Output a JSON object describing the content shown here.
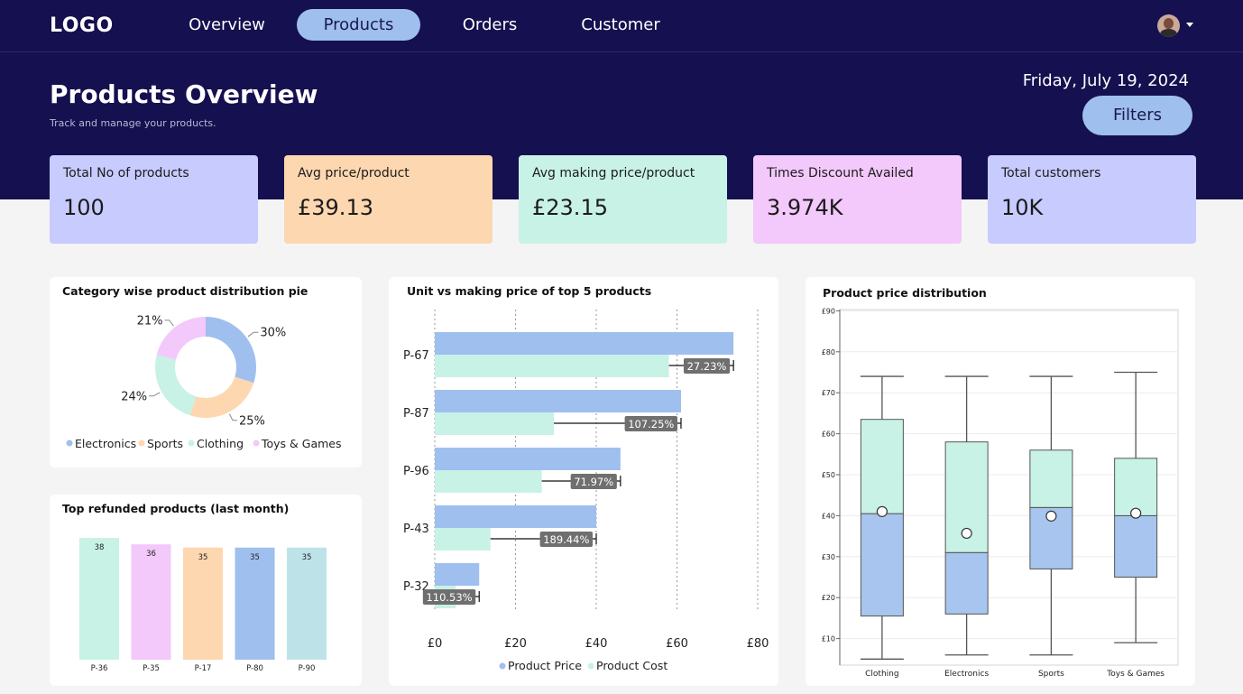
{
  "nav": {
    "logo": "LOGO",
    "items": [
      {
        "label": "Overview",
        "active": false
      },
      {
        "label": "Products",
        "active": true
      },
      {
        "label": "Orders",
        "active": false
      },
      {
        "label": "Customer",
        "active": false
      }
    ],
    "avatar_icon": "user-avatar",
    "menu_icon": "caret-down-icon"
  },
  "header": {
    "title": "Products Overview",
    "subtitle": "Track and manage your products.",
    "date": "Friday, July 19, 2024",
    "filters_label": "Filters"
  },
  "kpis": [
    {
      "label": "Total No of products",
      "value": "100",
      "color": "#c7cbfd"
    },
    {
      "label": "Avg price/product",
      "value": "£39.13",
      "color": "#fdd7b0"
    },
    {
      "label": "Avg making price/product",
      "value": "£23.15",
      "color": "#c8f2e6"
    },
    {
      "label": "Times Discount Availed",
      "value": "3.974K",
      "color": "#f3c8fb"
    },
    {
      "label": "Total customers",
      "value": "10K",
      "color": "#c7cbfd"
    }
  ],
  "cards": {
    "pie_title": "Category wise product distribution pie",
    "refund_title": "Top refunded products (last month)",
    "hbar_title": "Unit vs making price of top 5  products",
    "box_title": "Product price distribution"
  },
  "chart_data": [
    {
      "type": "pie",
      "title": "Category wise product distribution pie",
      "donut": true,
      "slices": [
        {
          "label": "Electronics",
          "value": 30,
          "text": "30%",
          "color": "#9fbfef"
        },
        {
          "label": "Sports",
          "value": 25,
          "text": "25%",
          "color": "#fdd7b0"
        },
        {
          "label": "Clothing",
          "value": 24,
          "text": "24%",
          "color": "#c8f2e6"
        },
        {
          "label": "Toys & Games",
          "value": 21,
          "text": "21%",
          "color": "#f3c8fb"
        }
      ],
      "legend_position": "bottom"
    },
    {
      "type": "bar",
      "title": "Top refunded products (last month)",
      "categories": [
        "P-36",
        "P-35",
        "P-17",
        "P-80",
        "P-90"
      ],
      "values": [
        38,
        36,
        35,
        35,
        35
      ],
      "colors": [
        "#c8f2e6",
        "#f3c8fb",
        "#fdd7b0",
        "#9fbfef",
        "#bde3e8"
      ],
      "ylim": [
        0,
        40
      ],
      "grid": false
    },
    {
      "type": "bar",
      "orientation": "horizontal",
      "title": "Unit vs making price of top 5  products",
      "categories": [
        "P-67",
        "P-87",
        "P-96",
        "P-43",
        "P-32"
      ],
      "series": [
        {
          "name": "Product Price",
          "values": [
            74,
            61,
            46,
            40,
            11
          ],
          "color": "#9fbfef"
        },
        {
          "name": "Product Cost",
          "values": [
            58,
            29.5,
            26.5,
            13.8,
            5.2
          ],
          "color": "#c8f2e6"
        }
      ],
      "annotations": [
        "27.23%",
        "107.25%",
        "71.97%",
        "189.44%",
        "110.53%"
      ],
      "xticks": [
        "£0",
        "£20",
        "£40",
        "£60",
        "£80"
      ],
      "xlim": [
        0,
        80
      ],
      "grid": true,
      "legend_position": "bottom"
    },
    {
      "type": "box",
      "title": "Product price distribution",
      "categories": [
        "Clothing",
        "Electronics",
        "Sports",
        "Toys & Games"
      ],
      "boxes": [
        {
          "min": 5,
          "q1": 15.5,
          "median": 40.5,
          "q3": 63.5,
          "max": 74,
          "mean": 41
        },
        {
          "min": 6,
          "q1": 16,
          "median": 31,
          "q3": 58,
          "max": 74,
          "mean": 35.7
        },
        {
          "min": 6,
          "q1": 27,
          "median": 42,
          "q3": 56,
          "max": 74,
          "mean": 39.9
        },
        {
          "min": 9,
          "q1": 25,
          "median": 40,
          "q3": 54,
          "max": 75,
          "mean": 40.6
        }
      ],
      "yticks": [
        "£10",
        "£20",
        "£30",
        "£40",
        "£50",
        "£60",
        "£70",
        "£80",
        "£90"
      ],
      "ylim": [
        5,
        90
      ],
      "lower_color": "#a7c5ee",
      "upper_color": "#c8f2e6",
      "grid": true
    }
  ]
}
